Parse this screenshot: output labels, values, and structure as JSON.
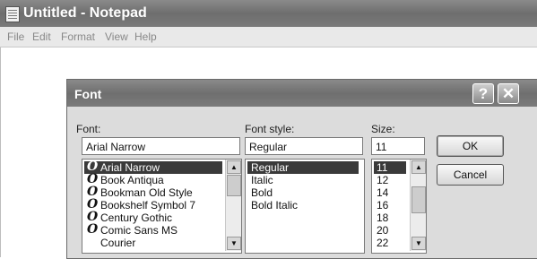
{
  "notepad": {
    "title": "Untitled - Notepad",
    "menu": [
      "File",
      "Edit",
      "Format",
      "View",
      "Help"
    ]
  },
  "dialog": {
    "title": "Font",
    "help_glyph": "?",
    "close_glyph": "✕",
    "font": {
      "label": "Font:",
      "value": "Arial Narrow",
      "items": [
        "Arial Narrow",
        "Book Antiqua",
        "Bookman Old Style",
        "Bookshelf Symbol 7",
        "Century Gothic",
        "Comic Sans MS",
        "Courier"
      ],
      "item_glyph": "O",
      "selected_index": 0
    },
    "style": {
      "label": "Font style:",
      "value": "Regular",
      "items": [
        "Regular",
        "Italic",
        "Bold",
        "Bold Italic"
      ],
      "selected_index": 0
    },
    "size": {
      "label": "Size:",
      "value": "11",
      "items": [
        "11",
        "12",
        "14",
        "16",
        "18",
        "20",
        "22"
      ],
      "selected_index": 0
    },
    "ok_label": "OK",
    "cancel_label": "Cancel"
  }
}
